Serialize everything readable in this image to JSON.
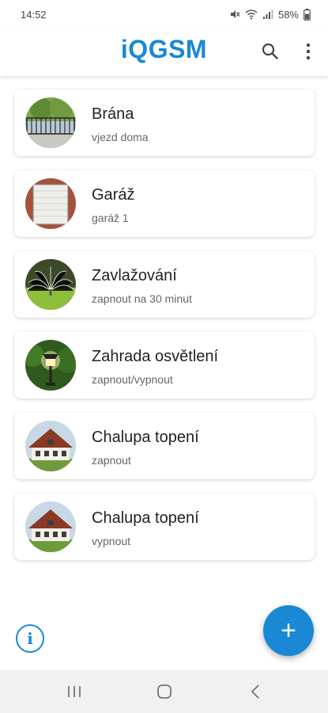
{
  "status_bar": {
    "time": "14:52",
    "battery": "58%",
    "icons": [
      "mute-icon",
      "wifi-icon",
      "signal-icon",
      "battery-icon"
    ]
  },
  "app_bar": {
    "title": "iQGSM",
    "actions": [
      "search-icon",
      "more-vert-icon"
    ],
    "accent_color": "#1a88d4"
  },
  "devices": [
    {
      "title": "Brána",
      "subtitle": "vjezd doma",
      "image": "gate"
    },
    {
      "title": "Garáž",
      "subtitle": "garáž 1",
      "image": "garage-door"
    },
    {
      "title": "Zavlažování",
      "subtitle": "zapnout na 30 minut",
      "image": "sprinkler"
    },
    {
      "title": "Zahrada osvětlení",
      "subtitle": "zapnout/vypnout",
      "image": "garden-lamp"
    },
    {
      "title": "Chalupa topení",
      "subtitle": "zapnout",
      "image": "cottage"
    },
    {
      "title": "Chalupa topení",
      "subtitle": "vypnout",
      "image": "cottage"
    }
  ],
  "buttons": {
    "info": "i",
    "add": "+"
  },
  "nav_bar": {
    "items": [
      "recent-apps-icon",
      "home-icon",
      "back-icon"
    ]
  }
}
